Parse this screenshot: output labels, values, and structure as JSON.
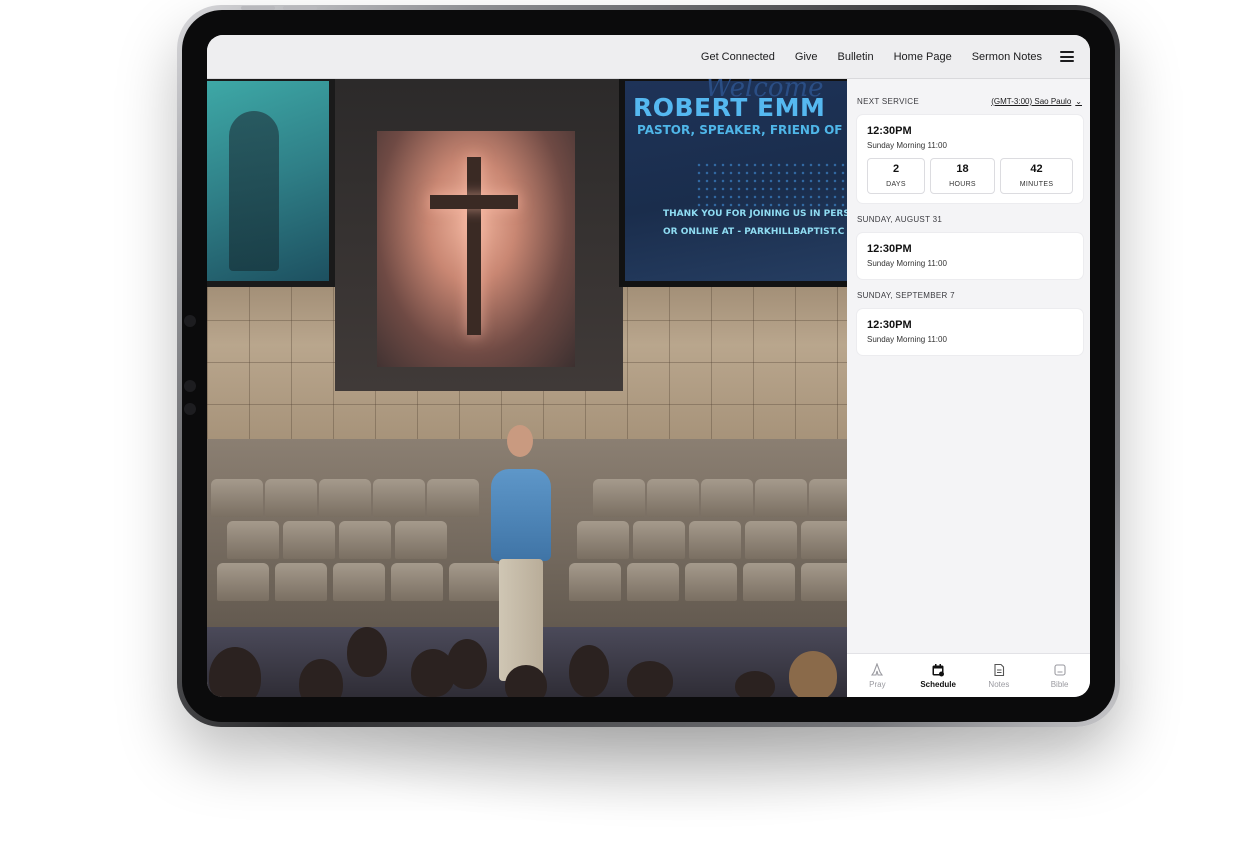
{
  "nav": {
    "links": [
      "Get Connected",
      "Give",
      "Bulletin",
      "Home Page",
      "Sermon Notes"
    ],
    "menu_icon": "hamburger-icon"
  },
  "stage_screen": {
    "name": "ROBERT EMM",
    "subtitle": "PASTOR, SPEAKER, FRIEND OF PA",
    "thanks_line1": "THANK YOU FOR JOINING US IN PERS",
    "thanks_line2": "OR ONLINE AT - PARKHILLBAPTIST.C"
  },
  "schedule": {
    "next_service_label": "NEXT SERVICE",
    "timezone": "(GMT-3:00) Sao Paulo",
    "next": {
      "time": "12:30PM",
      "name": "Sunday Morning 11:00",
      "countdown": [
        {
          "value": "2",
          "unit": "DAYS"
        },
        {
          "value": "18",
          "unit": "HOURS"
        },
        {
          "value": "42",
          "unit": "MINUTES"
        }
      ]
    },
    "days": [
      {
        "date": "SUNDAY, AUGUST 31",
        "time": "12:30PM",
        "name": "Sunday Morning 11:00"
      },
      {
        "date": "SUNDAY, SEPTEMBER 7",
        "time": "12:30PM",
        "name": "Sunday Morning 11:00"
      }
    ]
  },
  "tabs": [
    {
      "label": "Pray",
      "icon": "pray-icon",
      "active": false
    },
    {
      "label": "Schedule",
      "icon": "calendar-icon",
      "active": true
    },
    {
      "label": "Notes",
      "icon": "notes-icon",
      "active": false
    },
    {
      "label": "Bible",
      "icon": "bible-icon",
      "active": false
    }
  ],
  "colors": {
    "accent_text": "#111111",
    "inactive_tab": "#9a9aa0",
    "panel_bg": "#f4f4f6"
  }
}
